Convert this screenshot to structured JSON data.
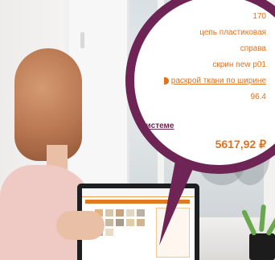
{
  "magnifier": {
    "rows": [
      "170",
      "цепь пластиковая",
      "справа",
      "скрин new p01",
      "раскрой ткани по ширине",
      "96.4"
    ],
    "system_link": "й системе",
    "price": "5617,92 ₽"
  },
  "colors": {
    "accent_orange": "#e07320",
    "ring_plum": "#6e2454"
  },
  "laptop_screen": {
    "swatch_colors": [
      "#e8b07a",
      "#d7c6a8",
      "#c9a27e",
      "#e3d6c3",
      "#b9b2a5",
      "#d9c9b4",
      "#c7b9a0",
      "#a99c8c",
      "#e2cda9",
      "#d2b690",
      "#bcae9c",
      "#e9dcc7"
    ]
  }
}
